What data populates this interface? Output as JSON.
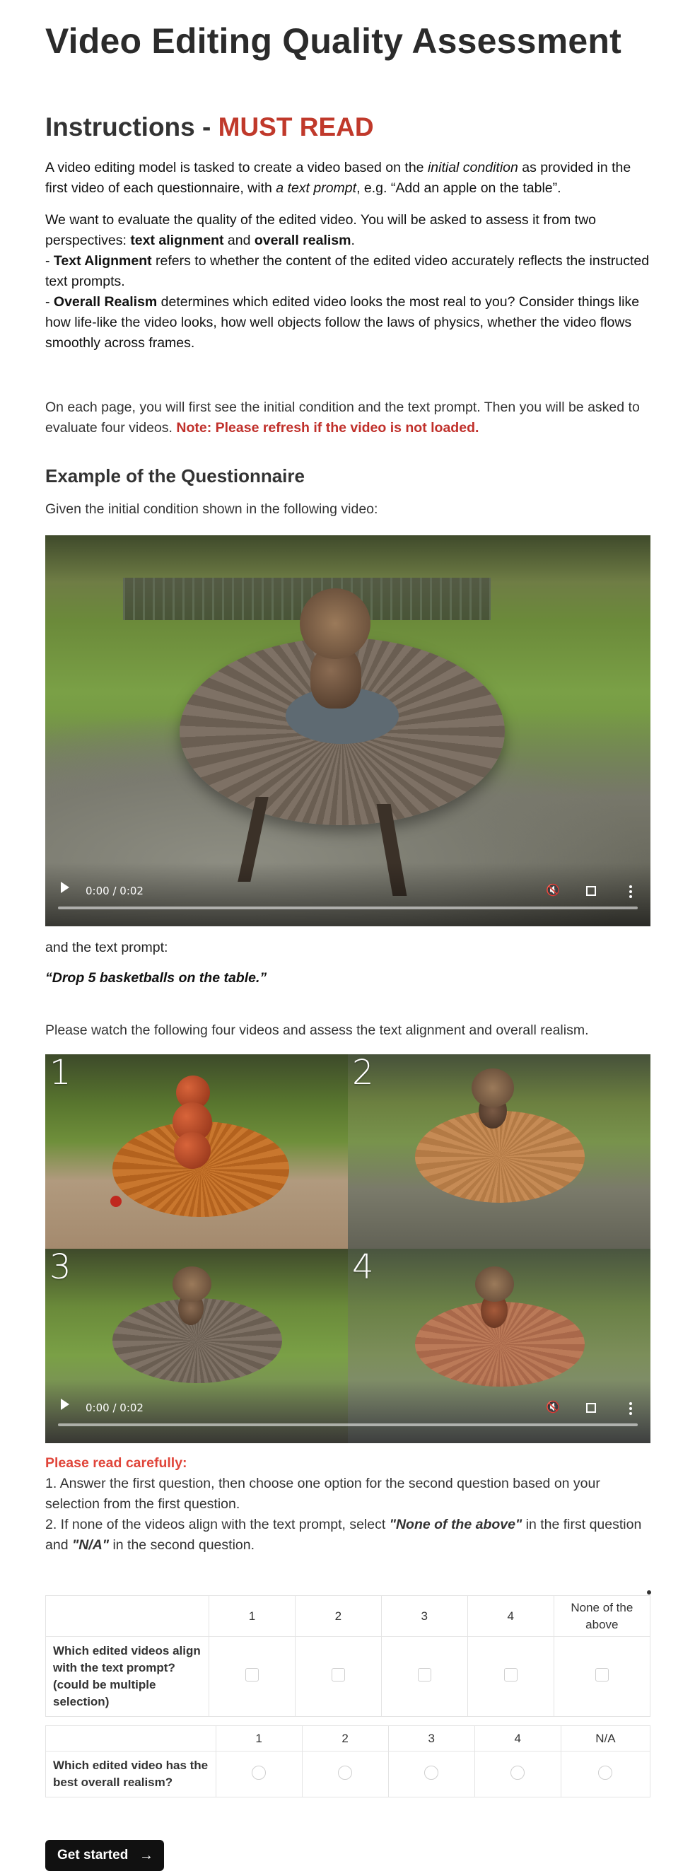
{
  "title": "Video Editing Quality Assessment",
  "instructions": {
    "heading_prefix": "Instructions - ",
    "heading_emph": "MUST READ",
    "p1": {
      "a": "A video editing model is tasked to create a video based on the ",
      "b": "initial condition",
      "c": " as provided in the first video of each questionnaire, with ",
      "d": "a text prompt",
      "e": ", e.g. “Add an apple on the table”."
    },
    "p2": {
      "a": "We want to evaluate the quality of the edited video. You will be asked to assess it from two perspectives: ",
      "b": "text alignment",
      "c": " and ",
      "d": "overall realism",
      "e": ".",
      "f_prefix": "- ",
      "f_bold": "Text Alignment",
      "f_rest": " refers to whether the content of the edited video accurately reflects the instructed text prompts.",
      "g_prefix": "- ",
      "g_bold": "Overall Realism",
      "g_rest": " determines which edited video looks the most real to you? Consider things like how life-like the video looks, how well objects follow the laws of physics, whether the video flows smoothly across frames."
    },
    "p3_a": "On each page, you will first see the initial condition and the text prompt. Then you will be asked to evaluate four videos. ",
    "p3_note": "Note: Please refresh if the video is not loaded."
  },
  "example": {
    "heading": "Example of the Questionnaire",
    "given": "Given the initial condition shown in the following video:",
    "video1_time": "0:00 / 0:02",
    "and_prompt": "and the text prompt:",
    "prompt": "“Drop 5 basketballs on the table.”",
    "watch": "Please watch the following four videos and assess the text alignment and overall realism.",
    "quad_labels": [
      "1",
      "2",
      "3",
      "4"
    ],
    "video2_time": "0:00 / 0:02"
  },
  "read_carefully": {
    "heading": "Please read carefully:",
    "rule1": "1. Answer the first question, then choose one option for the second question based on your selection from the first question.",
    "rule2_a": "2. If none of the videos align with the text prompt, select ",
    "rule2_b": "\"None of the above\"",
    "rule2_c": " in the first question and ",
    "rule2_d": "\"N/A\"",
    "rule2_e": " in the second question."
  },
  "question1": {
    "label": "Which edited videos align with the text prompt? (could be multiple selection)",
    "options": [
      "1",
      "2",
      "3",
      "4",
      "None of the above"
    ]
  },
  "question2": {
    "label": "Which edited video has the best overall realism?",
    "options": [
      "1",
      "2",
      "3",
      "4",
      "N/A"
    ]
  },
  "button": {
    "label": "Get started",
    "arrow": "→"
  },
  "icons": [
    "play-icon",
    "volume-icon",
    "fullscreen-icon",
    "more-icon",
    "arrow-right-icon"
  ]
}
